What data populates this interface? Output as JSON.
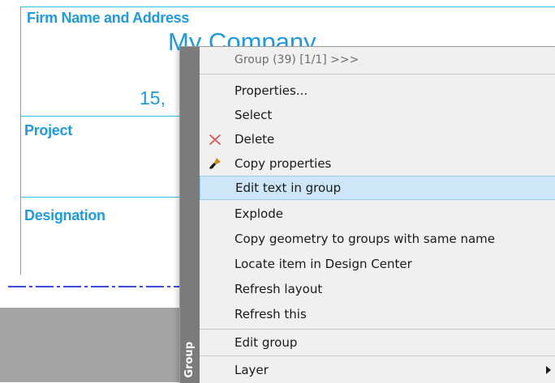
{
  "drawing": {
    "firm_label": "Firm Name and Address",
    "company": "My Company",
    "address_fragment": "15,",
    "project_label": "Project",
    "designation_label": "Designation"
  },
  "menu": {
    "side_label": "Group",
    "header": "Group (39) [1/1] >>>",
    "items": [
      {
        "label": "Properties...",
        "icon": null
      },
      {
        "label": "Select",
        "icon": null
      },
      {
        "label": "Delete",
        "icon": "delete-x-icon"
      },
      {
        "label": "Copy properties",
        "icon": "brush-icon"
      },
      {
        "label": "Edit text in group",
        "icon": null,
        "highlighted": true
      },
      {
        "label": "Explode",
        "icon": null
      },
      {
        "label": "Copy geometry to groups with same name",
        "icon": null
      },
      {
        "label": "Locate item in Design Center",
        "icon": null
      },
      {
        "label": "Refresh layout",
        "icon": null
      },
      {
        "label": "Refresh this",
        "icon": null
      },
      {
        "label": "Edit group",
        "icon": null
      },
      {
        "label": "Layer",
        "icon": null,
        "submenu": true
      }
    ]
  },
  "colors": {
    "titleblock_accent": "#1e9be0",
    "highlight": "#cde6f8",
    "strip": "#7b7b7b"
  }
}
